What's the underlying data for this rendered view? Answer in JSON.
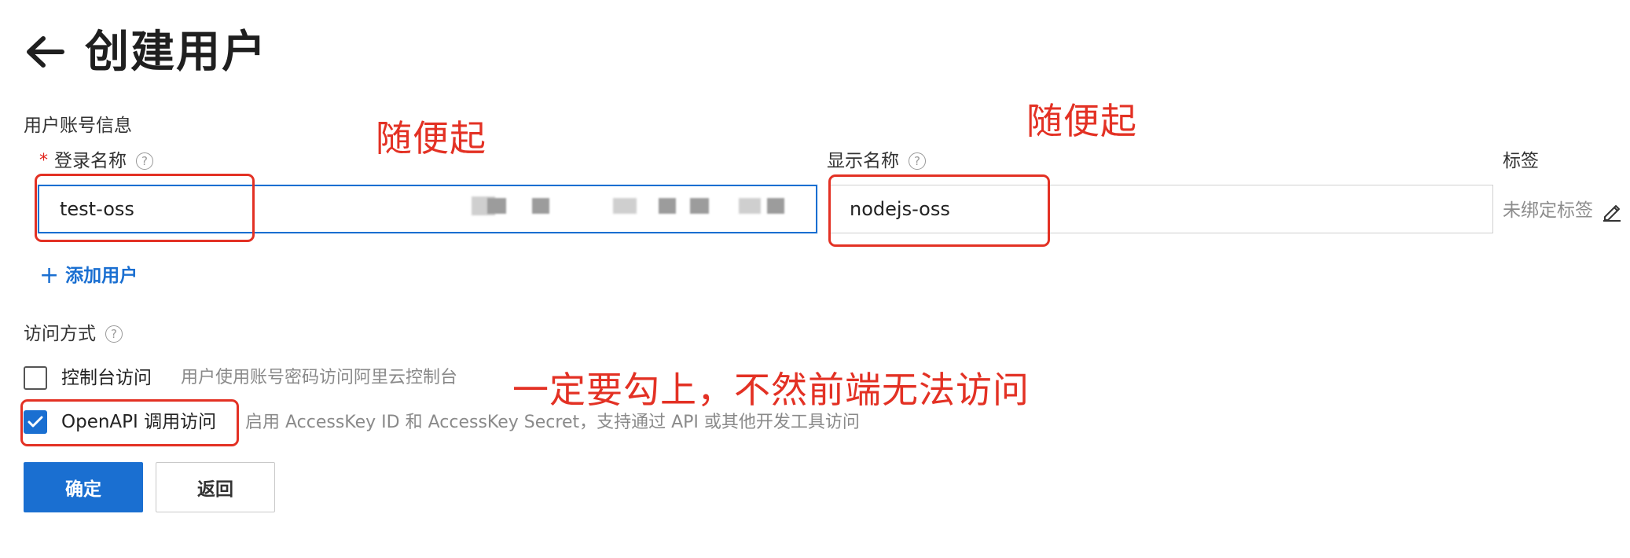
{
  "header": {
    "title": "创建用户"
  },
  "section": {
    "account_info": "用户账号信息",
    "access_method": "访问方式"
  },
  "fields": {
    "login_name": {
      "label": "登录名称",
      "required_mark": "*",
      "value": "test-oss"
    },
    "display_name": {
      "label": "显示名称",
      "value": "nodejs-oss"
    },
    "tags": {
      "label": "标签",
      "value": "未绑定标签"
    }
  },
  "add_user": {
    "plus": "+",
    "label": "添加用户"
  },
  "help_glyph": "?",
  "access_options": [
    {
      "label": "控制台访问",
      "description": "用户使用账号密码访问阿里云控制台",
      "checked": false
    },
    {
      "label": "OpenAPI 调用访问",
      "description": "启用 AccessKey ID 和 AccessKey Secret，支持通过 API 或其他开发工具访问",
      "checked": true
    }
  ],
  "buttons": {
    "confirm": "确定",
    "back": "返回"
  },
  "annotations": {
    "login_name_note": "随便起",
    "display_name_note": "随便起",
    "openapi_note": "一定要勾上，不然前端无法访问"
  },
  "colors": {
    "accent": "#1a6fd1",
    "annotation": "#e33124",
    "required": "#e2231a"
  },
  "icons": {
    "back": "arrow-left-icon",
    "help": "question-circle-icon",
    "edit": "pencil-icon",
    "check": "checkmark-icon"
  }
}
